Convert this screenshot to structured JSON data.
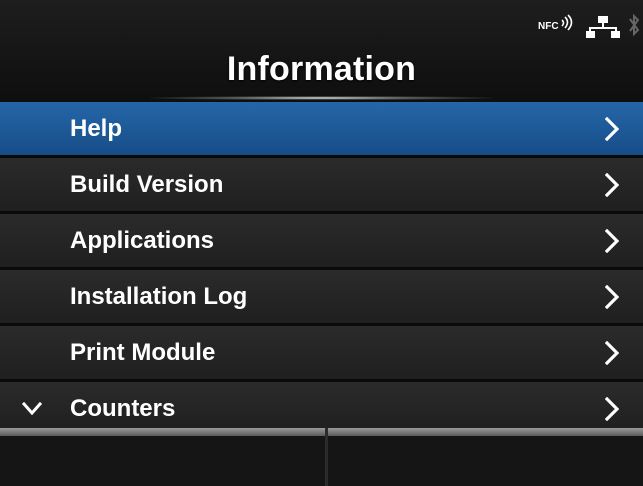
{
  "header": {
    "title": "Information",
    "status_icons": [
      "nfc-icon",
      "network-icon",
      "bluetooth-icon"
    ],
    "nfc_label": "NFC"
  },
  "menu": {
    "items": [
      {
        "label": "Help",
        "selected": true
      },
      {
        "label": "Build Version",
        "selected": false
      },
      {
        "label": "Applications",
        "selected": false
      },
      {
        "label": "Installation Log",
        "selected": false
      },
      {
        "label": "Print Module",
        "selected": false
      },
      {
        "label": "Counters",
        "selected": false
      }
    ]
  },
  "colors": {
    "selected_row": "#1f5c9e",
    "row": "#262626",
    "text": "#ffffff"
  }
}
